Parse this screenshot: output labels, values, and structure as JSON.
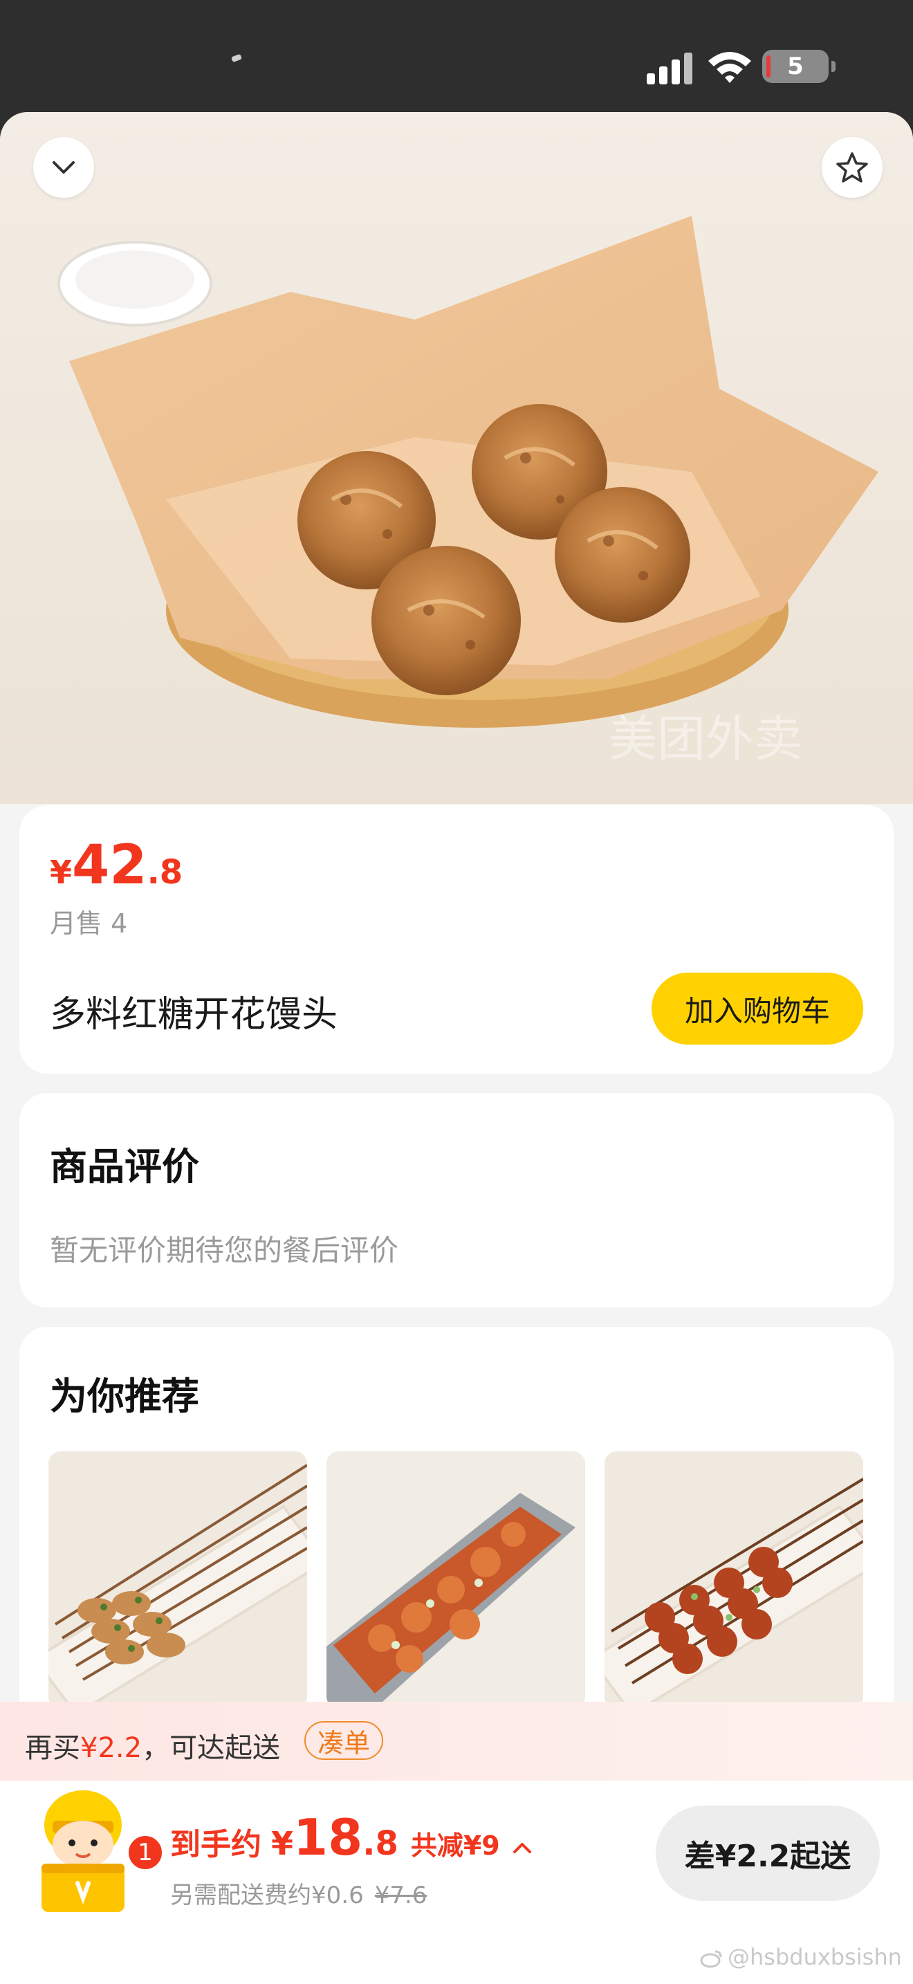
{
  "status_bar": {
    "battery": "5"
  },
  "product": {
    "currency": "¥",
    "price_int": "42",
    "price_dec": ".8",
    "monthly_sales": "月售 4",
    "name": "多料红糖开花馒头",
    "add_to_cart": "加入购物车"
  },
  "reviews": {
    "title": "商品评价",
    "empty_text": "暂无评价期待您的餐后评价"
  },
  "recommend": {
    "title": "为你推荐",
    "items": [
      {
        "image": "grilled-skewers-with-scallion"
      },
      {
        "image": "spicy-crayfish-tray"
      },
      {
        "image": "glazed-meat-skewers"
      }
    ]
  },
  "promo": {
    "prefix": "再买",
    "amount": "¥2.2",
    "suffix": "，可达起送",
    "button": "凑单"
  },
  "checkout": {
    "cart_count": "1",
    "label": "到手约",
    "currency": "¥",
    "price_int": "18",
    "price_dec": ".8",
    "discount": "共减¥9",
    "delivery_note": "另需配送费约¥0.6",
    "old_fee": "¥7.6",
    "cta": "差¥2.2起送"
  },
  "watermark": "@hsbduxbsishn",
  "colors": {
    "accent_red": "#f2361e",
    "brand_yellow": "#ffd100"
  }
}
